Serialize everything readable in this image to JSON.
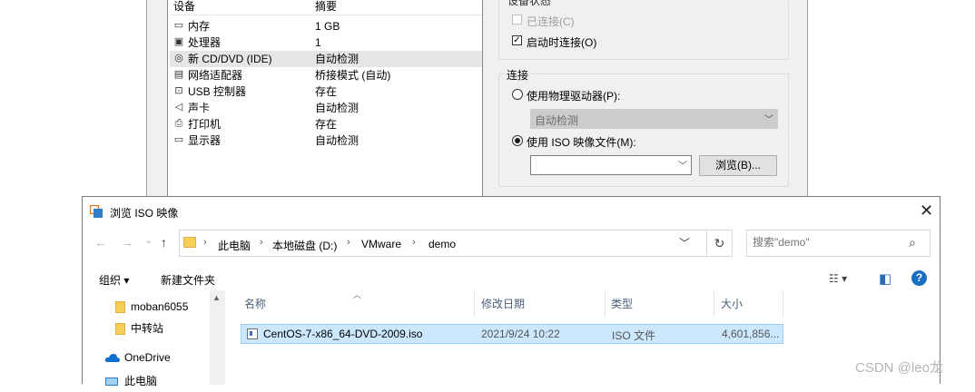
{
  "vm_settings": {
    "device_header": "设备",
    "summary_header": "摘要",
    "devices": [
      {
        "name": "内存",
        "value": "1 GB",
        "icon": "memory-icon"
      },
      {
        "name": "处理器",
        "value": "1",
        "icon": "processor-icon"
      },
      {
        "name": "新 CD/DVD (IDE)",
        "value": "自动检测",
        "icon": "cd-dvd-icon"
      },
      {
        "name": "网络适配器",
        "value": "桥接模式 (自动)",
        "icon": "network-adapter-icon"
      },
      {
        "name": "USB 控制器",
        "value": "存在",
        "icon": "usb-icon"
      },
      {
        "name": "声卡",
        "value": "自动检测",
        "icon": "sound-card-icon"
      },
      {
        "name": "打印机",
        "value": "存在",
        "icon": "printer-icon"
      },
      {
        "name": "显示器",
        "value": "自动检测",
        "icon": "display-icon"
      }
    ],
    "device_status": {
      "title": "设备状态",
      "connected_label": "已连接(C)",
      "connected_checked": false,
      "connect_at_power_on_label": "启动时连接(O)",
      "connect_at_power_on_checked": true
    },
    "connection": {
      "title": "连接",
      "physical_drive_label": "使用物理驱动器(P):",
      "physical_drive_value": "自动检测",
      "iso_label": "使用 ISO 映像文件(M):",
      "iso_value": "",
      "browse_label": "浏览(B)..."
    }
  },
  "iso_dialog": {
    "title": "浏览 ISO 映像",
    "close_glyph": "✕",
    "nav": {
      "back": "←",
      "forward": "→",
      "recent": "⌄",
      "up": "↑"
    },
    "breadcrumbs": [
      "此电脑",
      "本地磁盘 (D:)",
      "VMware",
      "demo"
    ],
    "breadcrumb_sep": "›",
    "search_placeholder": "搜索\"demo\"",
    "toolbar": {
      "organize": "组织 ▾",
      "new_folder": "新建文件夹",
      "view_glyph": "☷ ▾",
      "pane_glyph": "◧",
      "help_glyph": "?"
    },
    "nav_pane": [
      {
        "label": "moban6055",
        "icon": "folder-icon"
      },
      {
        "label": "中转站",
        "icon": "folder-icon"
      },
      {
        "label": "OneDrive",
        "icon": "onedrive-icon"
      },
      {
        "label": "此电脑",
        "icon": "this-pc-icon"
      }
    ],
    "columns": [
      "名称",
      "修改日期",
      "类型",
      "大小"
    ],
    "files": [
      {
        "name": "CentOS-7-x86_64-DVD-2009.iso",
        "modified": "2021/9/24 10:22",
        "type": "ISO 文件",
        "size": "4,601,856..."
      }
    ]
  },
  "watermark": "CSDN @leo龙",
  "colors": {
    "accent": "#0078d7",
    "selection": "#cce8ff",
    "dialog_bg": "#f0f0f0"
  }
}
